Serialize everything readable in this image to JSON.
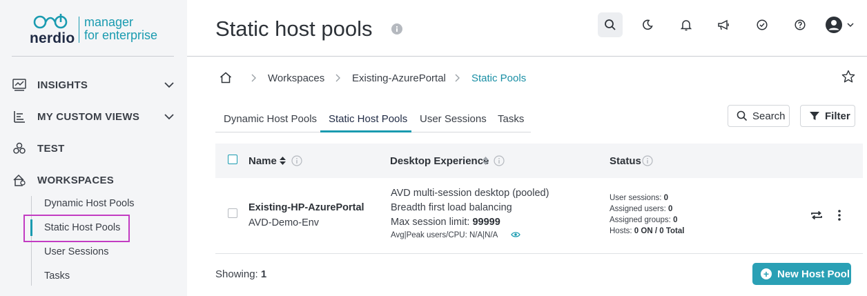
{
  "logo": {
    "brand": "nerdio",
    "product_line1": "manager",
    "product_line2": "for enterprise"
  },
  "sidebar": {
    "items": [
      {
        "label": "INSIGHTS",
        "icon": "insights-icon",
        "expandable": true
      },
      {
        "label": "MY CUSTOM VIEWS",
        "icon": "custom-views-icon",
        "expandable": true
      },
      {
        "label": "TEST",
        "icon": "test-icon",
        "expandable": false
      },
      {
        "label": "WORKSPACES",
        "icon": "workspaces-icon",
        "expandable": false
      }
    ],
    "sub_items": [
      {
        "label": "Dynamic Host Pools",
        "active": false
      },
      {
        "label": "Static Host Pools",
        "active": true
      },
      {
        "label": "User Sessions",
        "active": false
      },
      {
        "label": "Tasks",
        "active": false
      }
    ]
  },
  "header": {
    "title": "Static host pools",
    "icons": [
      "search-icon",
      "moon-icon",
      "bell-icon",
      "megaphone-icon",
      "check-circle-icon",
      "help-icon",
      "user-avatar-icon"
    ]
  },
  "breadcrumb": [
    "Workspaces",
    "Existing-AzurePortal",
    "Static Pools"
  ],
  "tabs": [
    "Dynamic Host Pools",
    "Static Host Pools",
    "User Sessions",
    "Tasks"
  ],
  "active_tab": "Static Host Pools",
  "toolbar": {
    "search_label": "Search",
    "filter_label": "Filter"
  },
  "table": {
    "columns": [
      "Name",
      "Desktop Experience",
      "Status"
    ],
    "rows": [
      {
        "name": "Existing-HP-AzurePortal",
        "workspace": "AVD-Demo-Env",
        "desktop_line1": "AVD multi-session desktop (pooled)",
        "desktop_line2": "Breadth first load balancing",
        "desktop_limit_label": "Max session limit: ",
        "desktop_limit_value": "99999",
        "desktop_usage": "Avg|Peak users/CPU: N/A|N/A",
        "status": {
          "user_sessions_label": "User sessions: ",
          "user_sessions": "0",
          "assigned_users_label": "Assigned users: ",
          "assigned_users": "0",
          "assigned_groups_label": "Assigned groups: ",
          "assigned_groups": "0",
          "hosts_label": "Hosts: ",
          "hosts": "0 ON / 0 Total"
        }
      }
    ]
  },
  "footer": {
    "showing_label": "Showing: ",
    "showing_count": "1",
    "new_button": "New Host Pool"
  },
  "colors": {
    "accent": "#1a9bb0",
    "highlight": "#c23bc2",
    "button": "#2aa0b5"
  }
}
